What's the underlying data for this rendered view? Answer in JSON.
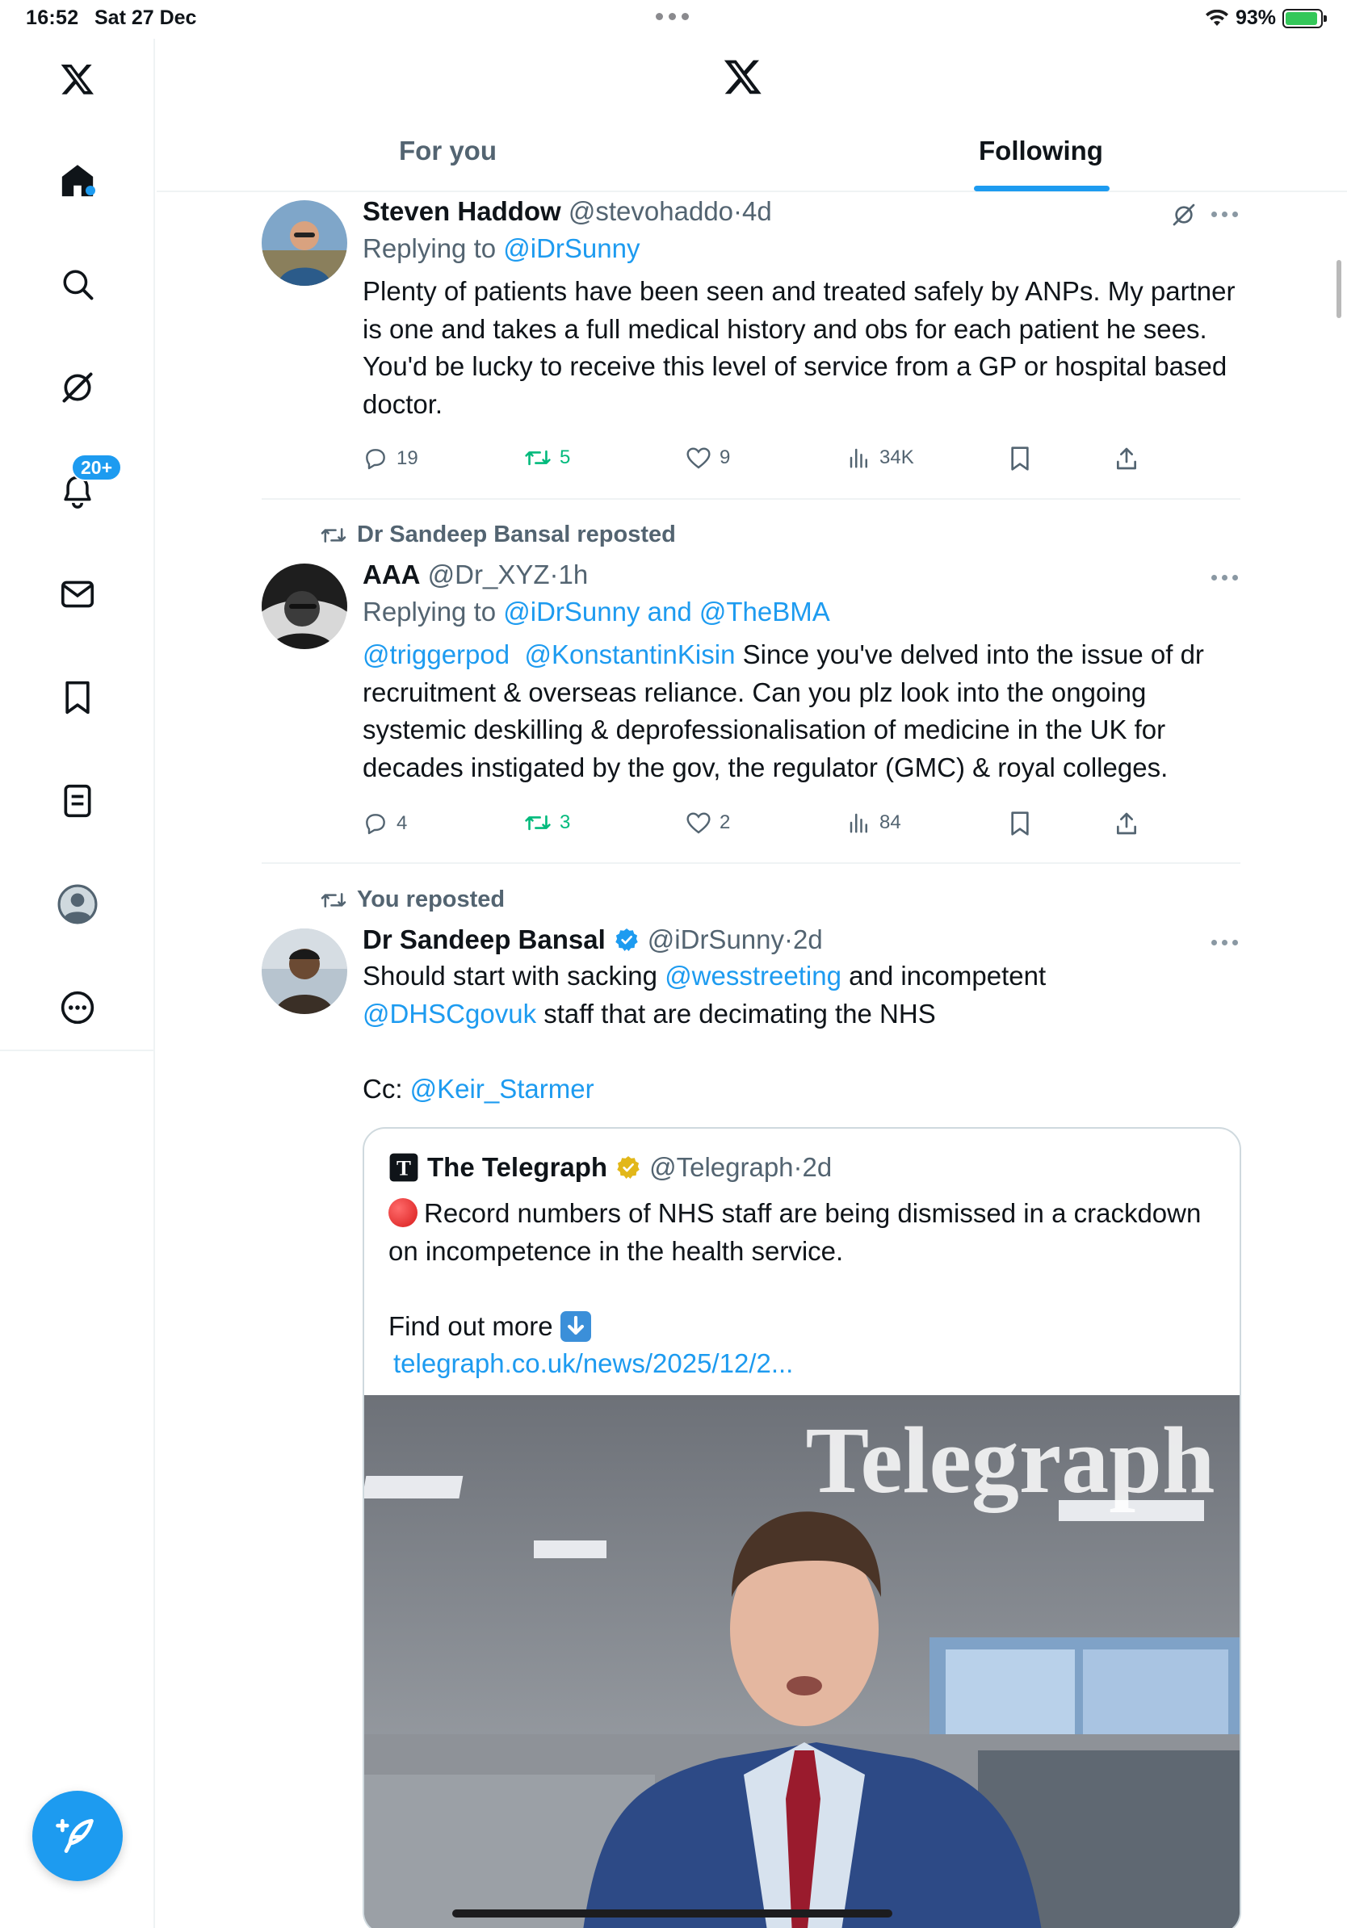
{
  "status_bar": {
    "time": "16:52",
    "date": "Sat 27 Dec",
    "battery": "93%"
  },
  "header": {
    "tabs": [
      {
        "label": "For you",
        "active": false
      },
      {
        "label": "Following",
        "active": true
      }
    ]
  },
  "sidebar": {
    "items": [
      "home-icon",
      "search-icon",
      "grok-icon",
      "notifications-icon",
      "messages-icon",
      "bookmarks-icon",
      "lists-icon",
      "profile-icon",
      "more-icon"
    ],
    "notification_badge": "20+"
  },
  "tweets": [
    {
      "name": "Steven Haddow",
      "handle": "@stevohaddo",
      "time": "4d",
      "replying_prefix": "Replying to ",
      "replying_to": "@iDrSunny",
      "text": "Plenty of patients have been seen and treated safely by ANPs. My partner is one and takes a full medical history and obs for each patient he sees. You'd be lucky to receive this level of service from a GP or hospital based doctor.",
      "replies": "19",
      "reposts": "5",
      "likes": "9",
      "views": "34K"
    },
    {
      "repost_note": "Dr Sandeep Bansal reposted",
      "name": "AAA",
      "handle": "@Dr_XYZ",
      "time": "1h",
      "replying_prefix": "Replying to ",
      "replying_to": "@iDrSunny and @TheBMA",
      "mention1": "@triggerpod",
      "mention2": "@KonstantinKisin",
      "text": " Since you've delved into the issue of dr recruitment & overseas reliance. Can you plz look into the ongoing systemic deskilling & deprofessionalisation of medicine in the UK for decades  instigated by the gov, the regulator (GMC) & royal colleges.",
      "replies": "4",
      "reposts": "3",
      "likes": "2",
      "views": "84"
    },
    {
      "repost_note": "You reposted",
      "name": "Dr Sandeep Bansal",
      "handle": "@iDrSunny",
      "time": "2d",
      "text_a": "Should start with sacking ",
      "mention_a": "@wesstreeting",
      "text_b": " and incompetent",
      "mention_b": "@DHSCgovuk",
      "text_c": " staff that are decimating the NHS",
      "cc_prefix": "Cc: ",
      "mention_c": "@Keir_Starmer",
      "quote": {
        "name": "The Telegraph",
        "handle": "@Telegraph",
        "time": "2d",
        "text": "Record numbers of NHS staff are being dismissed in a crackdown on incompetence in the health service.",
        "find_more": "Find out more",
        "link": "telegraph.co.uk/news/2025/12/2...",
        "image_watermark": "Telegraph"
      }
    }
  ],
  "colors": {
    "accent": "#1d9bf0",
    "repost_green": "#00ba7c",
    "muted": "#536471"
  }
}
